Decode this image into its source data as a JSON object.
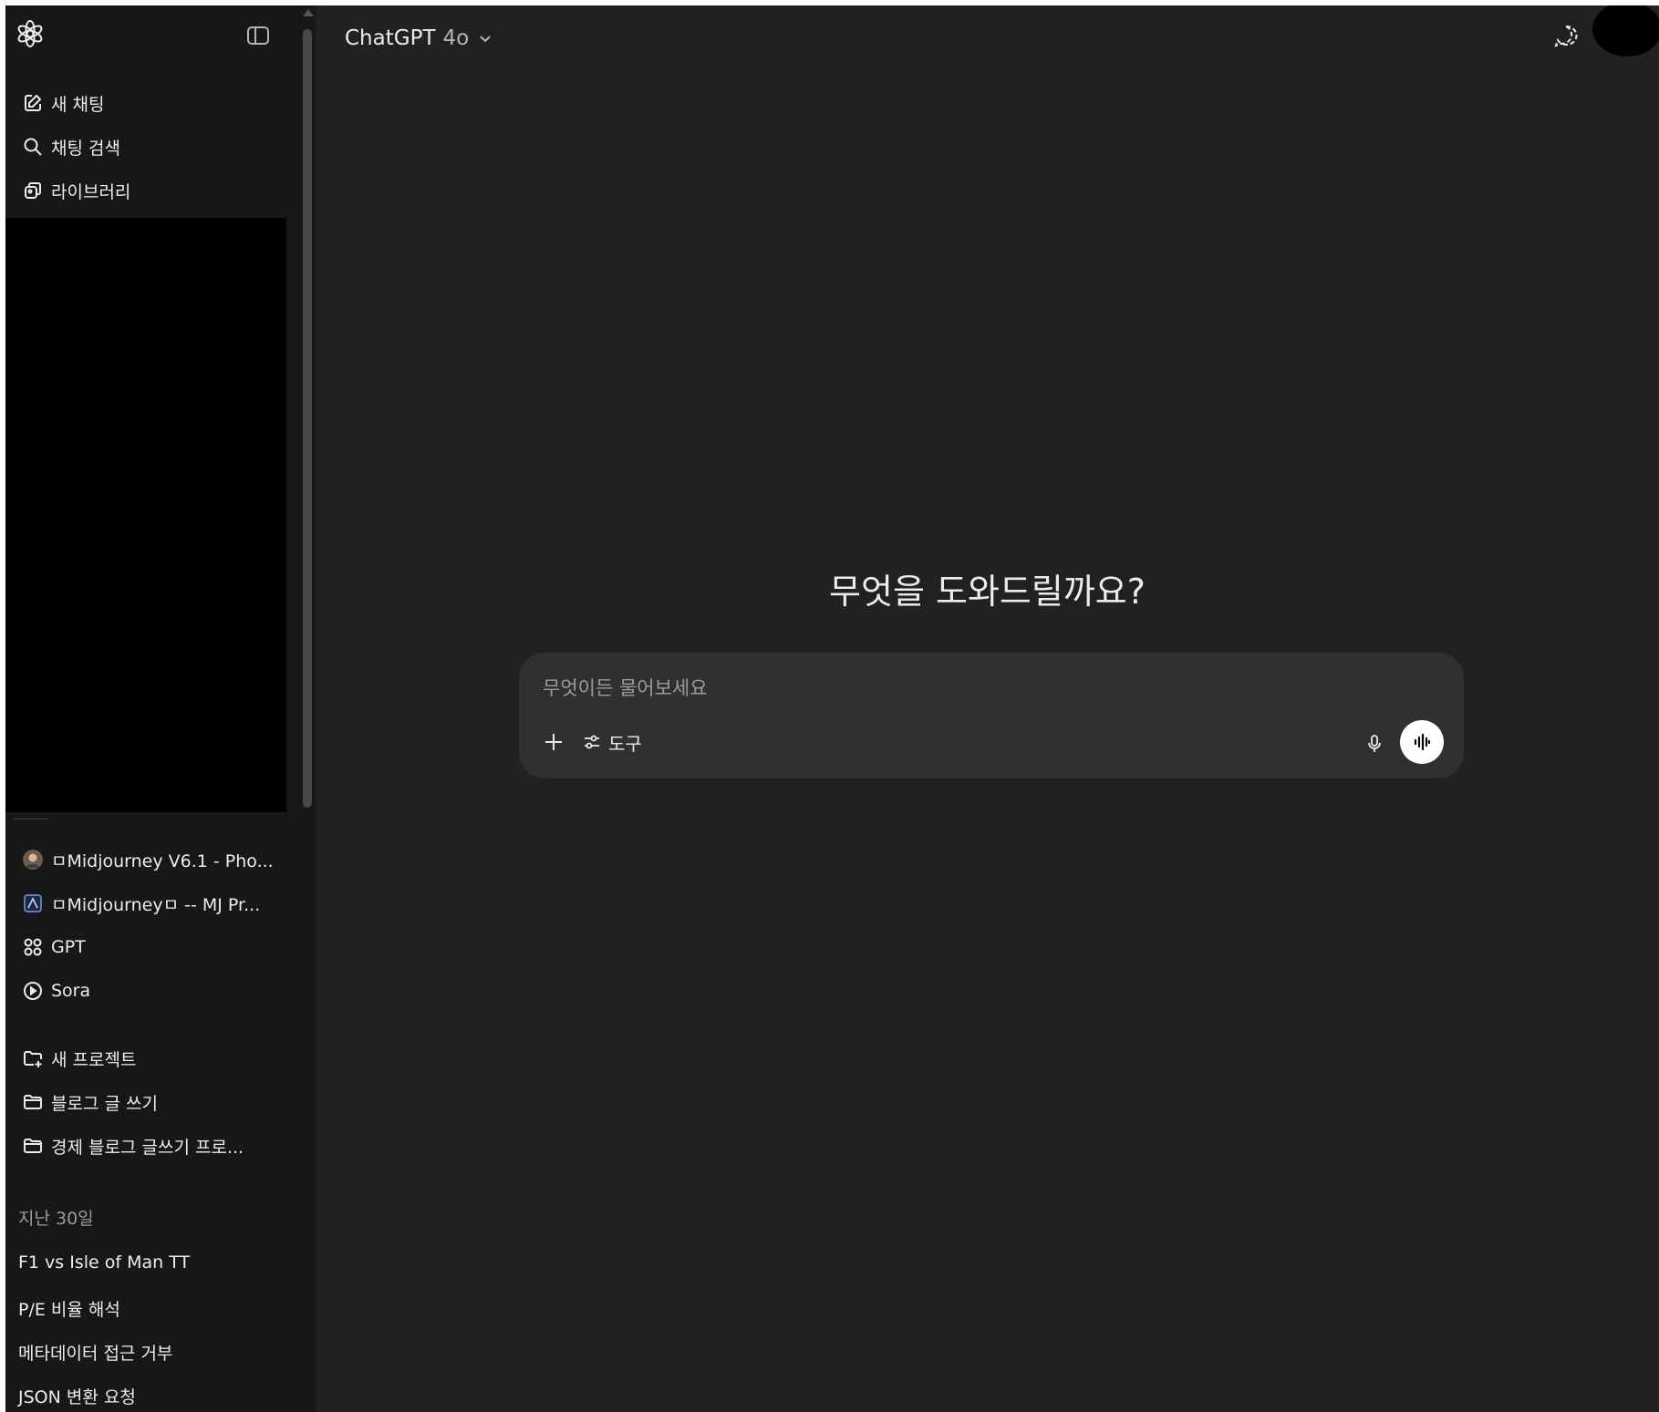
{
  "header": {
    "model_name": "ChatGPT",
    "model_version": "4o"
  },
  "sidebar": {
    "actions": [
      {
        "label": "새 채팅",
        "icon": "edit-icon"
      },
      {
        "label": "채팅 검색",
        "icon": "search-icon"
      },
      {
        "label": "라이브러리",
        "icon": "library-icon"
      }
    ],
    "gpts": [
      {
        "label": "ㅁMidjourney V6.1 - Pho...",
        "icon": "avatar-icon"
      },
      {
        "label": "ㅁMidjourneyㅁ -- MJ Pr...",
        "icon": "mj-icon"
      },
      {
        "label": "GPT",
        "icon": "grid-icon"
      },
      {
        "label": "Sora",
        "icon": "play-circle-icon"
      }
    ],
    "projects": [
      {
        "label": "새 프로젝트",
        "icon": "folder-plus-icon"
      },
      {
        "label": "블로그 글 쓰기",
        "icon": "folder-icon"
      },
      {
        "label": "경제 블로그 글쓰기 프로...",
        "icon": "folder-icon"
      }
    ],
    "section_title": "지난 30일",
    "chats": [
      "F1 vs Isle of Man TT",
      "P/E 비율 해석",
      "메타데이터 접근 거부",
      "JSON 변환 요청"
    ]
  },
  "main": {
    "greeting": "무엇을 도와드릴까요?",
    "composer": {
      "placeholder": "무엇이든 물어보세요",
      "tools_label": "도구"
    }
  },
  "colors": {
    "sidebar_bg": "#171717",
    "main_bg": "#212121",
    "composer_bg": "#303030",
    "text": "#ececec",
    "muted": "#9b9b9b"
  }
}
